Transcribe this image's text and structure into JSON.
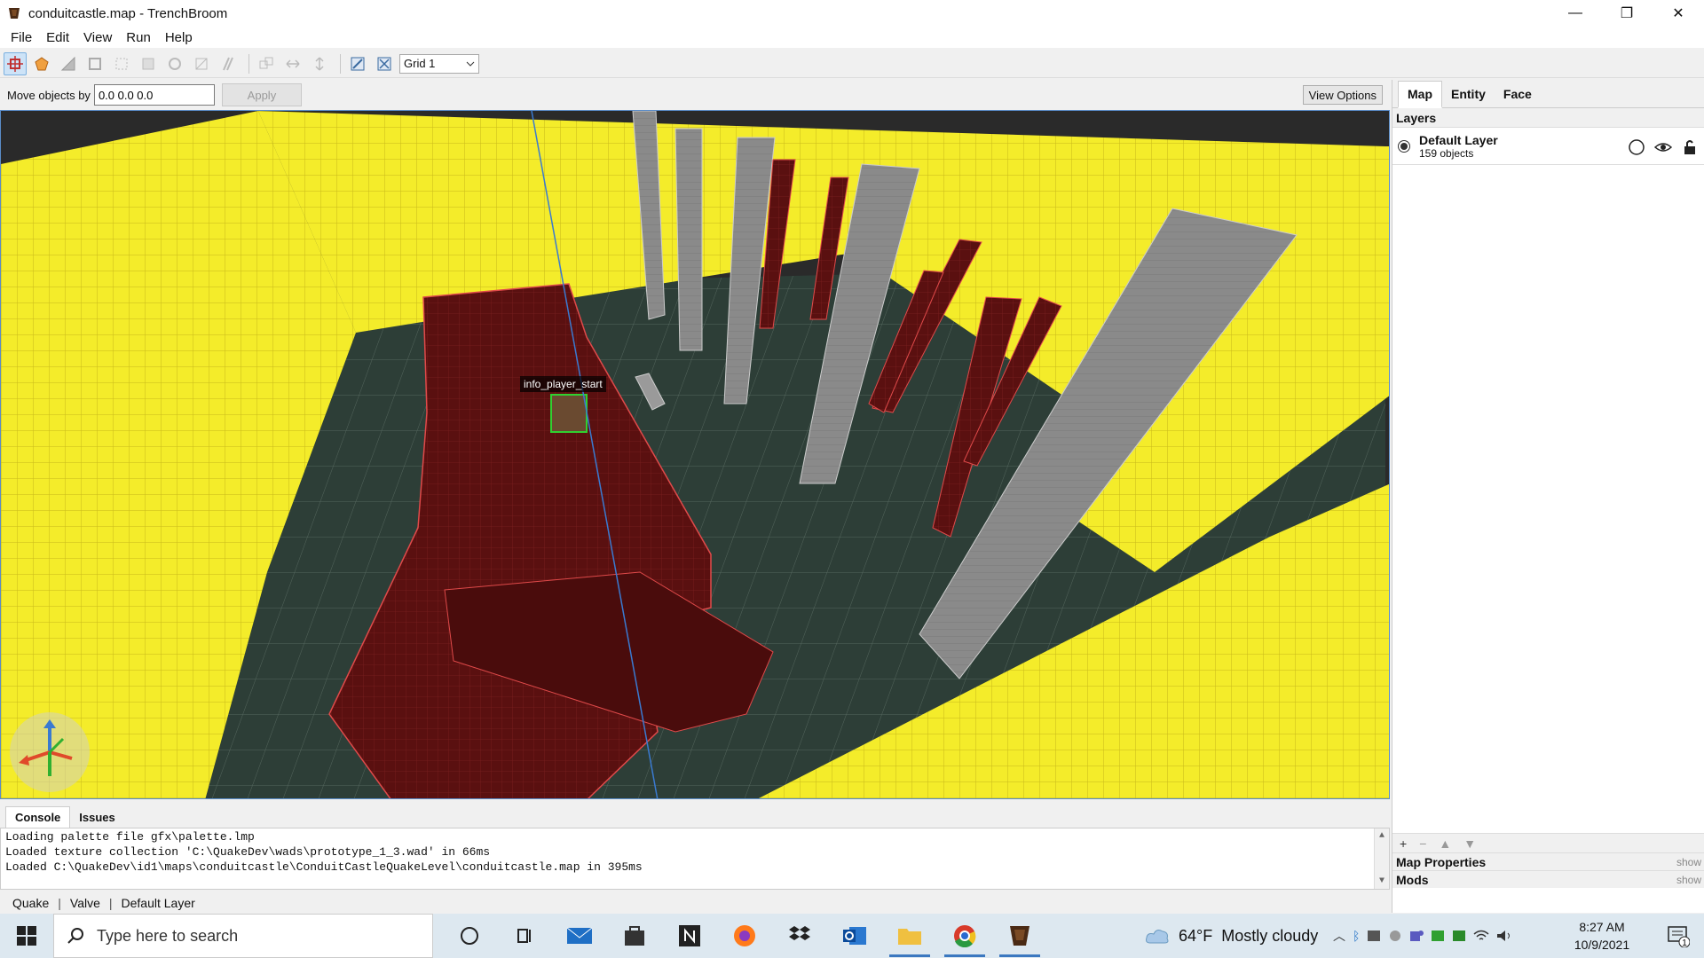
{
  "window": {
    "title": "conduitcastle.map - TrenchBroom",
    "minimize_glyph": "—",
    "restore_glyph": "❐",
    "close_glyph": "✕"
  },
  "menu": [
    "File",
    "Edit",
    "View",
    "Run",
    "Help"
  ],
  "toolbar": {
    "tools": [
      "move-tool",
      "vertex-tool",
      "edge-tool",
      "face-tool",
      "rotate-tool",
      "scale-tool",
      "shear-tool",
      "clip-tool",
      "texture-lock",
      "uv-lock"
    ],
    "grid_select": "Grid 1"
  },
  "move_bar": {
    "label": "Move objects by",
    "input_value": "0.0 0.0 0.0",
    "apply_label": "Apply",
    "view_options_label": "View Options"
  },
  "viewport": {
    "entity_label": "info_player_start",
    "wall_color": "#f4ec2a",
    "floor_color": "#2d3e37",
    "brush_color": "#5a1010",
    "pillar_color": "#8a8a8a"
  },
  "bottom_tabs": [
    "Console",
    "Issues"
  ],
  "console_lines": [
    "Loading palette file gfx\\palette.lmp",
    "Loaded texture collection 'C:\\QuakeDev\\wads\\prototype_1_3.wad' in 66ms",
    "Loaded C:\\QuakeDev\\id1\\maps\\conduitcastle\\ConduitCastleQuakeLevel\\conduitcastle.map in 395ms"
  ],
  "status_bar": [
    "Quake",
    "Valve",
    "Default Layer"
  ],
  "right_panel": {
    "tabs": [
      "Map",
      "Entity",
      "Face"
    ],
    "layers_header": "Layers",
    "layer": {
      "name": "Default Layer",
      "count": "159 objects"
    },
    "sections": [
      {
        "name": "Map Properties",
        "action": "show"
      },
      {
        "name": "Mods",
        "action": "show"
      }
    ]
  },
  "taskbar": {
    "search_placeholder": "Type here to search",
    "weather_temp": "64°F",
    "weather_desc": "Mostly cloudy",
    "time": "8:27 AM",
    "date": "10/9/2021",
    "notification_count": "1"
  }
}
